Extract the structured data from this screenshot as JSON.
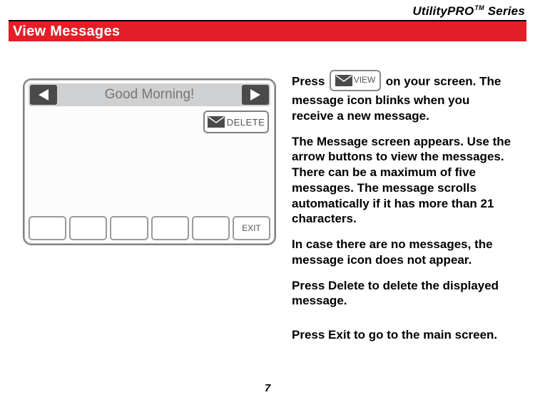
{
  "series": {
    "name": "UtilityPRO",
    "tm": "TM",
    "suffix": " Series"
  },
  "section_title": "View Messages",
  "thermostat": {
    "title": "Good Morning!",
    "delete_label": "DELETE",
    "exit_label": "EXIT"
  },
  "view_button": {
    "label": "VIEW"
  },
  "instructions": {
    "p1_a": "Press ",
    "p1_b": " on your screen. The message icon blinks when you receive a new message.",
    "p2": "The Message screen appears. Use the arrow buttons to view the messages. There can be a maximum of five messages. The message scrolls automatically if it has more than 21 characters.",
    "p3": "In case there are no messages, the message icon does not appear.",
    "p4_a": "Press ",
    "p4_strong": "Delete",
    "p4_b": " to delete the displayed message.",
    "p5_a": "Press ",
    "p5_strong": "Exit",
    "p5_b": " to go to the main screen."
  },
  "page_number": "7"
}
